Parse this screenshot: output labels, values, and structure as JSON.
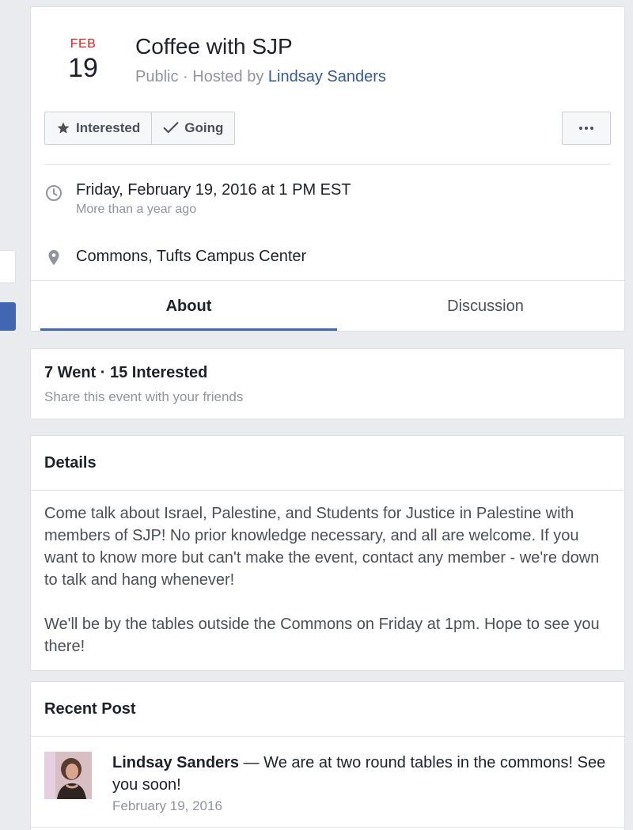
{
  "event": {
    "date_month": "FEB",
    "date_day": "19",
    "title": "Coffee with SJP",
    "privacy": "Public",
    "hosted_by_prefix": "Hosted by",
    "host": "Lindsay Sanders",
    "separator": "·"
  },
  "actions": {
    "interested_label": "Interested",
    "going_label": "Going",
    "more_icon": "more-icon"
  },
  "when": {
    "datetime": "Friday, February 19, 2016 at 1 PM EST",
    "relative": "More than a year ago",
    "icon": "clock-icon"
  },
  "where": {
    "location": "Commons, Tufts Campus Center",
    "icon": "map-pin-icon"
  },
  "tabs": [
    {
      "label": "About",
      "active": true
    },
    {
      "label": "Discussion",
      "active": false
    }
  ],
  "stats": {
    "summary": "7 Went · 15 Interested",
    "share_text": "Share this event with your friends"
  },
  "details": {
    "heading": "Details",
    "paragraphs": [
      "Come talk about Israel, Palestine, and Students for Justice in Palestine with members of SJP! No prior knowledge necessary, and all are welcome. If you want to know more but can't make the event, contact any member - we're down to talk and hang whenever!",
      "We'll be by the tables outside the Commons on Friday at 1pm. Hope to see you there!"
    ]
  },
  "recent_post": {
    "heading": "Recent Post",
    "author": "Lindsay Sanders",
    "text": " — We are at two round tables in the commons! See you soon!",
    "date": "February 19, 2016"
  },
  "colors": {
    "accent": "#4267b2",
    "link": "#365899",
    "date_month": "#e02020",
    "muted": "#90949c",
    "page_bg": "#e9ebee"
  }
}
